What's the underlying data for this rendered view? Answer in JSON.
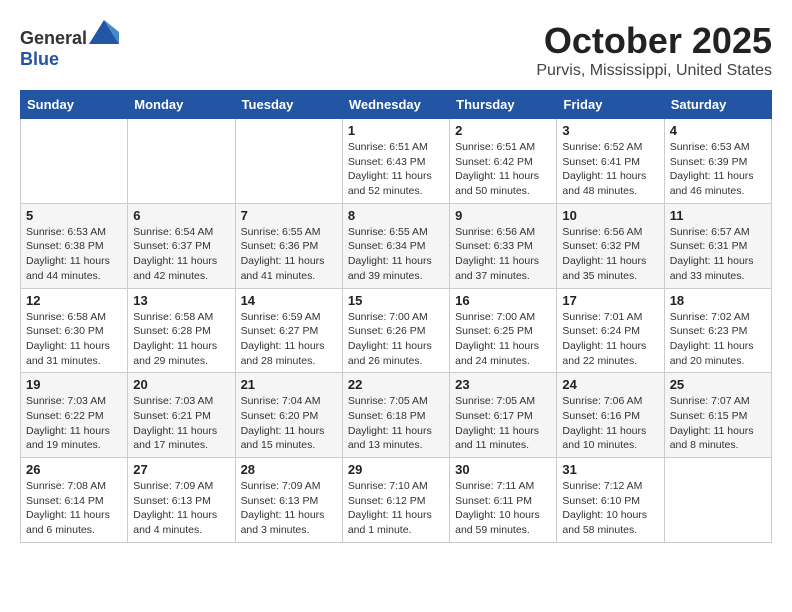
{
  "header": {
    "logo_general": "General",
    "logo_blue": "Blue",
    "month_title": "October 2025",
    "location": "Purvis, Mississippi, United States"
  },
  "days_of_week": [
    "Sunday",
    "Monday",
    "Tuesday",
    "Wednesday",
    "Thursday",
    "Friday",
    "Saturday"
  ],
  "weeks": [
    [
      {
        "day": "",
        "info": ""
      },
      {
        "day": "",
        "info": ""
      },
      {
        "day": "",
        "info": ""
      },
      {
        "day": "1",
        "info": "Sunrise: 6:51 AM\nSunset: 6:43 PM\nDaylight: 11 hours\nand 52 minutes."
      },
      {
        "day": "2",
        "info": "Sunrise: 6:51 AM\nSunset: 6:42 PM\nDaylight: 11 hours\nand 50 minutes."
      },
      {
        "day": "3",
        "info": "Sunrise: 6:52 AM\nSunset: 6:41 PM\nDaylight: 11 hours\nand 48 minutes."
      },
      {
        "day": "4",
        "info": "Sunrise: 6:53 AM\nSunset: 6:39 PM\nDaylight: 11 hours\nand 46 minutes."
      }
    ],
    [
      {
        "day": "5",
        "info": "Sunrise: 6:53 AM\nSunset: 6:38 PM\nDaylight: 11 hours\nand 44 minutes."
      },
      {
        "day": "6",
        "info": "Sunrise: 6:54 AM\nSunset: 6:37 PM\nDaylight: 11 hours\nand 42 minutes."
      },
      {
        "day": "7",
        "info": "Sunrise: 6:55 AM\nSunset: 6:36 PM\nDaylight: 11 hours\nand 41 minutes."
      },
      {
        "day": "8",
        "info": "Sunrise: 6:55 AM\nSunset: 6:34 PM\nDaylight: 11 hours\nand 39 minutes."
      },
      {
        "day": "9",
        "info": "Sunrise: 6:56 AM\nSunset: 6:33 PM\nDaylight: 11 hours\nand 37 minutes."
      },
      {
        "day": "10",
        "info": "Sunrise: 6:56 AM\nSunset: 6:32 PM\nDaylight: 11 hours\nand 35 minutes."
      },
      {
        "day": "11",
        "info": "Sunrise: 6:57 AM\nSunset: 6:31 PM\nDaylight: 11 hours\nand 33 minutes."
      }
    ],
    [
      {
        "day": "12",
        "info": "Sunrise: 6:58 AM\nSunset: 6:30 PM\nDaylight: 11 hours\nand 31 minutes."
      },
      {
        "day": "13",
        "info": "Sunrise: 6:58 AM\nSunset: 6:28 PM\nDaylight: 11 hours\nand 29 minutes."
      },
      {
        "day": "14",
        "info": "Sunrise: 6:59 AM\nSunset: 6:27 PM\nDaylight: 11 hours\nand 28 minutes."
      },
      {
        "day": "15",
        "info": "Sunrise: 7:00 AM\nSunset: 6:26 PM\nDaylight: 11 hours\nand 26 minutes."
      },
      {
        "day": "16",
        "info": "Sunrise: 7:00 AM\nSunset: 6:25 PM\nDaylight: 11 hours\nand 24 minutes."
      },
      {
        "day": "17",
        "info": "Sunrise: 7:01 AM\nSunset: 6:24 PM\nDaylight: 11 hours\nand 22 minutes."
      },
      {
        "day": "18",
        "info": "Sunrise: 7:02 AM\nSunset: 6:23 PM\nDaylight: 11 hours\nand 20 minutes."
      }
    ],
    [
      {
        "day": "19",
        "info": "Sunrise: 7:03 AM\nSunset: 6:22 PM\nDaylight: 11 hours\nand 19 minutes."
      },
      {
        "day": "20",
        "info": "Sunrise: 7:03 AM\nSunset: 6:21 PM\nDaylight: 11 hours\nand 17 minutes."
      },
      {
        "day": "21",
        "info": "Sunrise: 7:04 AM\nSunset: 6:20 PM\nDaylight: 11 hours\nand 15 minutes."
      },
      {
        "day": "22",
        "info": "Sunrise: 7:05 AM\nSunset: 6:18 PM\nDaylight: 11 hours\nand 13 minutes."
      },
      {
        "day": "23",
        "info": "Sunrise: 7:05 AM\nSunset: 6:17 PM\nDaylight: 11 hours\nand 11 minutes."
      },
      {
        "day": "24",
        "info": "Sunrise: 7:06 AM\nSunset: 6:16 PM\nDaylight: 11 hours\nand 10 minutes."
      },
      {
        "day": "25",
        "info": "Sunrise: 7:07 AM\nSunset: 6:15 PM\nDaylight: 11 hours\nand 8 minutes."
      }
    ],
    [
      {
        "day": "26",
        "info": "Sunrise: 7:08 AM\nSunset: 6:14 PM\nDaylight: 11 hours\nand 6 minutes."
      },
      {
        "day": "27",
        "info": "Sunrise: 7:09 AM\nSunset: 6:13 PM\nDaylight: 11 hours\nand 4 minutes."
      },
      {
        "day": "28",
        "info": "Sunrise: 7:09 AM\nSunset: 6:13 PM\nDaylight: 11 hours\nand 3 minutes."
      },
      {
        "day": "29",
        "info": "Sunrise: 7:10 AM\nSunset: 6:12 PM\nDaylight: 11 hours\nand 1 minute."
      },
      {
        "day": "30",
        "info": "Sunrise: 7:11 AM\nSunset: 6:11 PM\nDaylight: 10 hours\nand 59 minutes."
      },
      {
        "day": "31",
        "info": "Sunrise: 7:12 AM\nSunset: 6:10 PM\nDaylight: 10 hours\nand 58 minutes."
      },
      {
        "day": "",
        "info": ""
      }
    ]
  ]
}
